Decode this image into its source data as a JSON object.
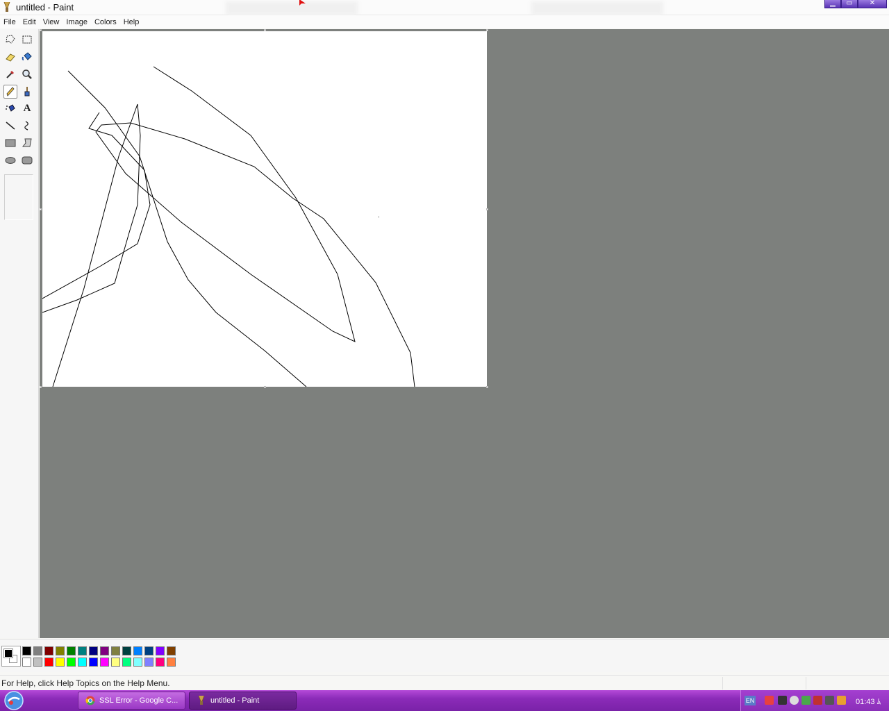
{
  "window": {
    "title": "untitled - Paint",
    "buttons": {
      "minimize": "▁",
      "maximize": "▭",
      "close": "✕"
    }
  },
  "menu": [
    "File",
    "Edit",
    "View",
    "Image",
    "Colors",
    "Help"
  ],
  "tools": [
    {
      "name": "free-form-select-icon"
    },
    {
      "name": "select-icon"
    },
    {
      "name": "eraser-icon"
    },
    {
      "name": "fill-with-color-icon"
    },
    {
      "name": "pick-color-icon"
    },
    {
      "name": "magnifier-icon"
    },
    {
      "name": "pencil-icon",
      "selected": true
    },
    {
      "name": "brush-icon"
    },
    {
      "name": "airbrush-icon"
    },
    {
      "name": "text-icon",
      "glyph": "A"
    },
    {
      "name": "line-icon"
    },
    {
      "name": "curve-icon"
    },
    {
      "name": "rectangle-icon"
    },
    {
      "name": "polygon-icon"
    },
    {
      "name": "ellipse-icon"
    },
    {
      "name": "rounded-rectangle-icon"
    }
  ],
  "palette": {
    "foreground": "#000000",
    "background": "#ffffff",
    "row1": [
      "#000000",
      "#808080",
      "#800000",
      "#808000",
      "#008000",
      "#008080",
      "#000080",
      "#800080",
      "#808040",
      "#004040",
      "#0080ff",
      "#004080",
      "#8000ff",
      "#804000"
    ],
    "row2": [
      "#ffffff",
      "#c0c0c0",
      "#ff0000",
      "#ffff00",
      "#00ff00",
      "#00ffff",
      "#0000ff",
      "#ff00ff",
      "#ffff80",
      "#00ff80",
      "#80ffff",
      "#8080ff",
      "#ff0080",
      "#ff8040"
    ]
  },
  "status": {
    "help_text": "For Help, click Help Topics on the Help Menu."
  },
  "taskbar": {
    "tasks": [
      {
        "label": "SSL Error - Google C...",
        "active": false
      },
      {
        "label": "untitled - Paint",
        "active": true
      }
    ],
    "language": "EN",
    "clock": "01:43 ﾑ"
  }
}
